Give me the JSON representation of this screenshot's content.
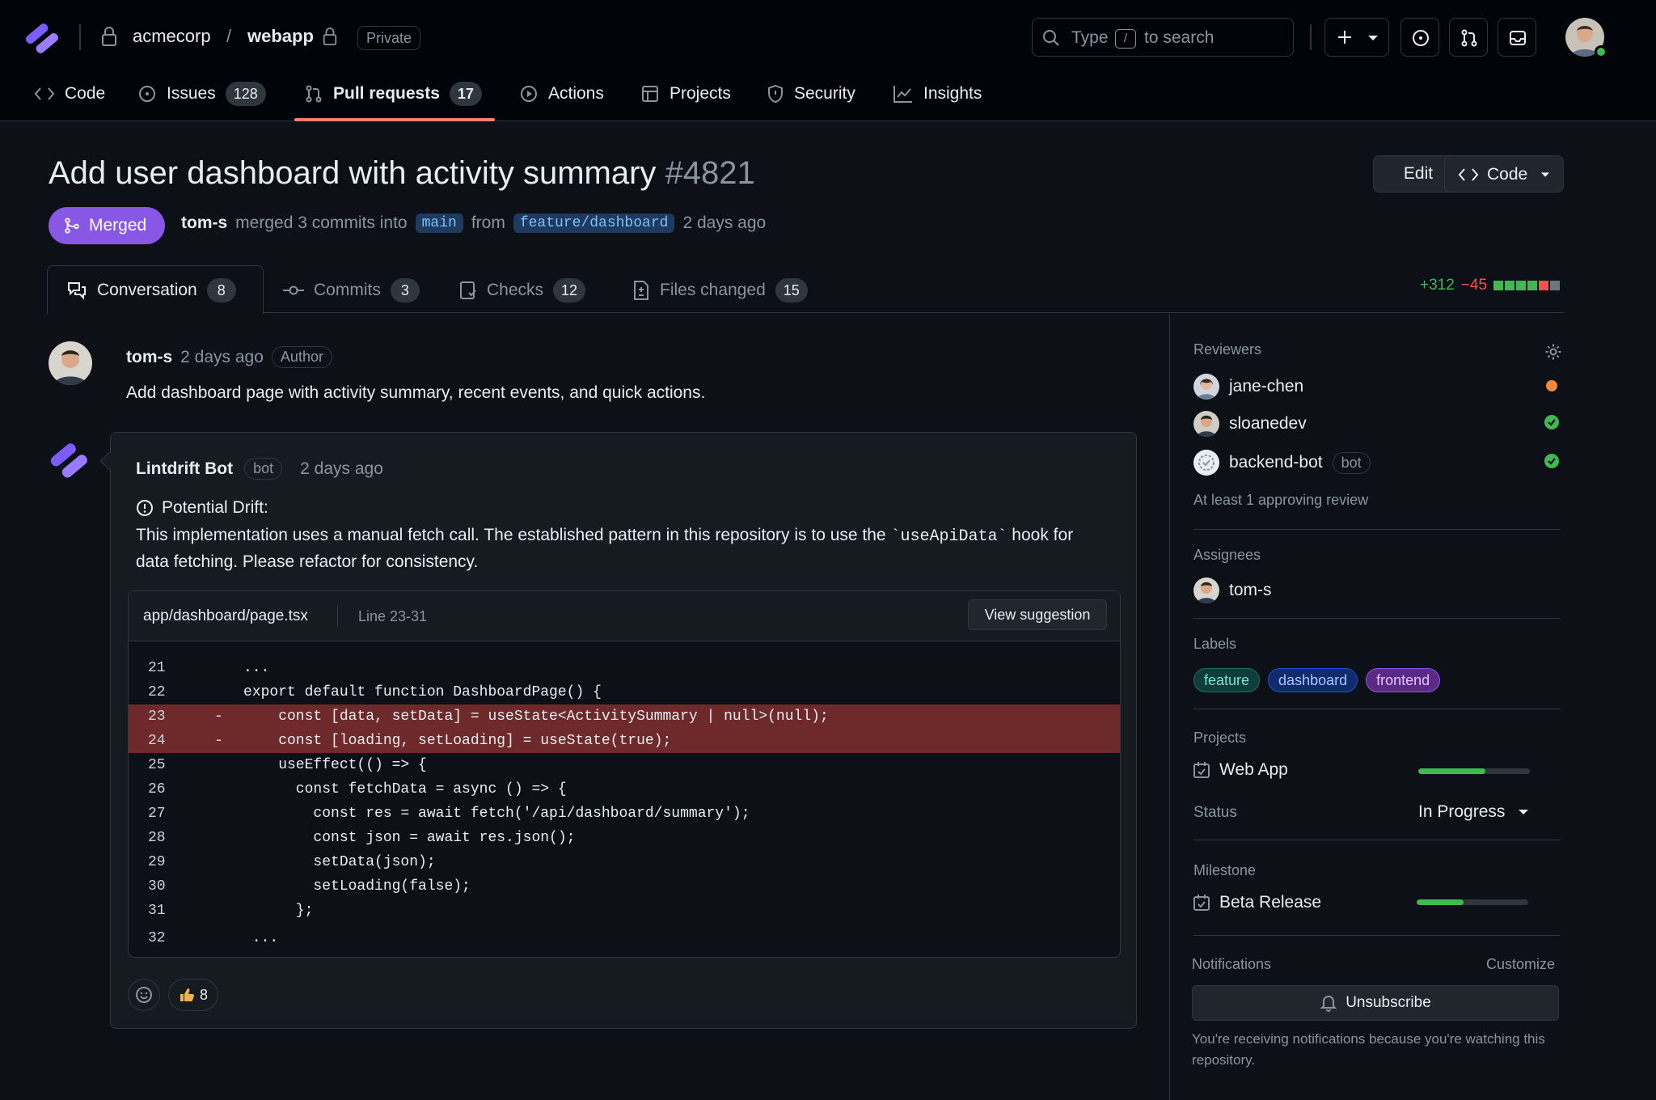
{
  "header": {
    "repo_owner": "acmecorp",
    "repo_separator": "/",
    "repo_name": "webapp",
    "visibility": "Private",
    "search_prefix": "Type",
    "search_key": "/",
    "search_suffix": "to search"
  },
  "nav": {
    "items": [
      {
        "label": "Code",
        "icon": "code-icon"
      },
      {
        "label": "Issues",
        "count": "128",
        "icon": "issue-icon"
      },
      {
        "label": "Pull requests",
        "count": "17",
        "icon": "pull-request-icon",
        "active": true
      },
      {
        "label": "Actions",
        "icon": "play-icon"
      },
      {
        "label": "Projects",
        "icon": "table-icon"
      },
      {
        "label": "Security",
        "icon": "shield-icon"
      },
      {
        "label": "Insights",
        "icon": "graph-icon"
      }
    ]
  },
  "pr": {
    "title": "Add user dashboard with activity summary",
    "number": "#4821",
    "edit_label": "Edit",
    "code_label": "Code",
    "state": "Merged",
    "author": "tom-s",
    "merge_text": "merged 3 commits into",
    "base_branch": "main",
    "from_text": "from",
    "head_branch": "feature/dashboard",
    "time": "2 days ago"
  },
  "tabs": [
    {
      "label": "Conversation",
      "count": "8",
      "icon": "comment-icon"
    },
    {
      "label": "Commits",
      "count": "3",
      "icon": "commit-icon"
    },
    {
      "label": "Checks",
      "count": "12",
      "icon": "checklist-icon"
    },
    {
      "label": "Files changed",
      "count": "15",
      "icon": "file-diff-icon"
    }
  ],
  "diffstat": {
    "additions": "+312",
    "deletions": "−45"
  },
  "comment": {
    "author": "tom-s",
    "time": "2 days ago",
    "role": "Author",
    "body": "Add dashboard page with activity summary, recent events, and quick actions."
  },
  "bot": {
    "name": "Lintdrift Bot",
    "tag": "bot",
    "time": "2 days ago",
    "drift_title": "Potential Drift:",
    "drift_text_before": "This implementation uses a manual fetch call. The established pattern in this repository is to use the ",
    "drift_code": "`useApiData`",
    "drift_text_after": " hook for data fetching. Please refactor for consistency.",
    "file": "app/dashboard/page.tsx",
    "lines_label": "Line 23-31",
    "view_suggestion": "View suggestion",
    "code": [
      {
        "n": "21",
        "m": "",
        "s": "...",
        "del": false
      },
      {
        "n": "22",
        "m": "",
        "s": "export default function DashboardPage() {",
        "del": false
      },
      {
        "n": "23",
        "m": "-",
        "s": "    const [data, setData] = useState<ActivitySummary | null>(null);",
        "del": true
      },
      {
        "n": "24",
        "m": "-",
        "s": "    const [loading, setLoading] = useState(true);",
        "del": true
      },
      {
        "n": "25",
        "m": "",
        "s": "    useEffect(() => {",
        "del": false
      },
      {
        "n": "26",
        "m": "",
        "s": "      const fetchData = async () => {",
        "del": false
      },
      {
        "n": "27",
        "m": "",
        "s": "        const res = await fetch('/api/dashboard/summary');",
        "del": false
      },
      {
        "n": "28",
        "m": "",
        "s": "        const json = await res.json();",
        "del": false
      },
      {
        "n": "29",
        "m": "",
        "s": "        setData(json);",
        "del": false
      },
      {
        "n": "30",
        "m": "",
        "s": "        setLoading(false);",
        "del": false
      },
      {
        "n": "31",
        "m": "",
        "s": "      };",
        "del": false
      },
      {
        "n": "32",
        "m": "",
        "s": " ...",
        "del": false
      }
    ],
    "reaction_count": "8"
  },
  "sidebar": {
    "reviewers_title": "Reviewers",
    "reviewers": [
      {
        "name": "jane-chen",
        "status": "pending",
        "color": "#f0883e"
      },
      {
        "name": "sloanedev",
        "status": "approved",
        "color": "#3fb950"
      },
      {
        "name": "backend-bot",
        "tag": "bot",
        "status": "approved",
        "color": "#3fb950"
      }
    ],
    "reviewers_note": "At least 1 approving review",
    "assignees_title": "Assignees",
    "assignee": "tom-s",
    "labels_title": "Labels",
    "labels": [
      {
        "name": "feature",
        "bg": "#0f3d3a",
        "border": "#1f6f67",
        "color": "#7ee2d4"
      },
      {
        "name": "dashboard",
        "bg": "#102a6b",
        "border": "#1f4fd1",
        "color": "#a5c8ff"
      },
      {
        "name": "frontend",
        "bg": "#5b2a86",
        "border": "#8957e5",
        "color": "#e2c5ff"
      }
    ],
    "projects_title": "Projects",
    "project_name": "Web App",
    "project_progress": 0.6,
    "status_label": "Status",
    "status_value": "In Progress",
    "milestone_title": "Milestone",
    "milestone_name": "Beta Release",
    "milestone_progress": 0.42,
    "notifications_title": "Notifications",
    "customize": "Customize",
    "unsubscribe": "Unsubscribe",
    "notification_text": "You're receiving notifications because you're watching this repository."
  }
}
